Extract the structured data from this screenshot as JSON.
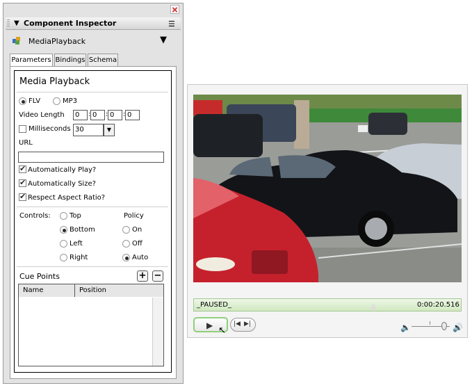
{
  "inspector": {
    "title": "Component Inspector",
    "component_name": "MediaPlayback",
    "tabs": [
      "Parameters",
      "Bindings",
      "Schema"
    ],
    "active_tab": "Parameters",
    "section_title": "Media Playback",
    "format": {
      "options": [
        "FLV",
        "MP3"
      ],
      "selected": "FLV"
    },
    "video_length": {
      "label": "Video Length",
      "fields": [
        "0",
        "0",
        "0",
        "0"
      ],
      "separator": ":"
    },
    "milliseconds": {
      "label": "Milliseconds",
      "checked": false,
      "fps_value": "30"
    },
    "url": {
      "label": "URL",
      "value": ""
    },
    "checkboxes": [
      {
        "label": "Automatically Play?",
        "checked": true
      },
      {
        "label": "Automatically Size?",
        "checked": true
      },
      {
        "label": "Respect Aspect Ratio?",
        "checked": true
      }
    ],
    "controls": {
      "label": "Controls:",
      "options": [
        "Top",
        "Bottom",
        "Left",
        "Right"
      ],
      "selected": "Bottom"
    },
    "policy": {
      "label": "Policy",
      "options": [
        "On",
        "Off",
        "Auto"
      ],
      "selected": "Auto"
    },
    "cue_points": {
      "label": "Cue Points",
      "add": "+",
      "remove": "−",
      "columns": [
        "Name",
        "Position"
      ],
      "rows": []
    }
  },
  "player": {
    "status": "_PAUSED_",
    "time": "0:00:20.516",
    "progress_fraction": 0.67,
    "volume_fraction": 0.85,
    "icons": [
      "play-icon",
      "rewind-icon",
      "fast-forward-icon",
      "volume-low-icon",
      "volume-high-icon"
    ]
  },
  "colors": {
    "progress_green": "#cfe9bf",
    "play_border": "#8fcf7a",
    "close_red": "#d04040"
  }
}
